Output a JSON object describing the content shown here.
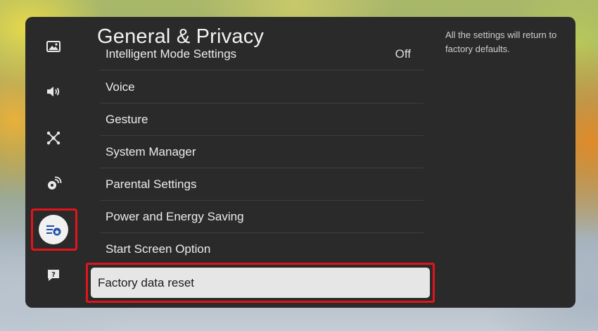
{
  "header": {
    "title": "General & Privacy"
  },
  "sidebar": {
    "icons": [
      "picture-icon",
      "sound-icon",
      "connection-icon",
      "support-broadcast-icon",
      "general-privacy-icon",
      "help-icon"
    ]
  },
  "menu": {
    "items": [
      {
        "label": "Intelligent Mode Settings",
        "value": "Off"
      },
      {
        "label": "Voice",
        "value": ""
      },
      {
        "label": "Gesture",
        "value": ""
      },
      {
        "label": "System Manager",
        "value": ""
      },
      {
        "label": "Parental Settings",
        "value": ""
      },
      {
        "label": "Power and Energy Saving",
        "value": ""
      },
      {
        "label": "Start Screen Option",
        "value": ""
      }
    ],
    "focused": {
      "label": "Factory data reset"
    }
  },
  "description": {
    "text": "All the settings will return to factory defaults."
  },
  "colors": {
    "panel": "#2a2a2b",
    "highlight": "#e3141b",
    "focus_bg": "#e6e6e6"
  }
}
